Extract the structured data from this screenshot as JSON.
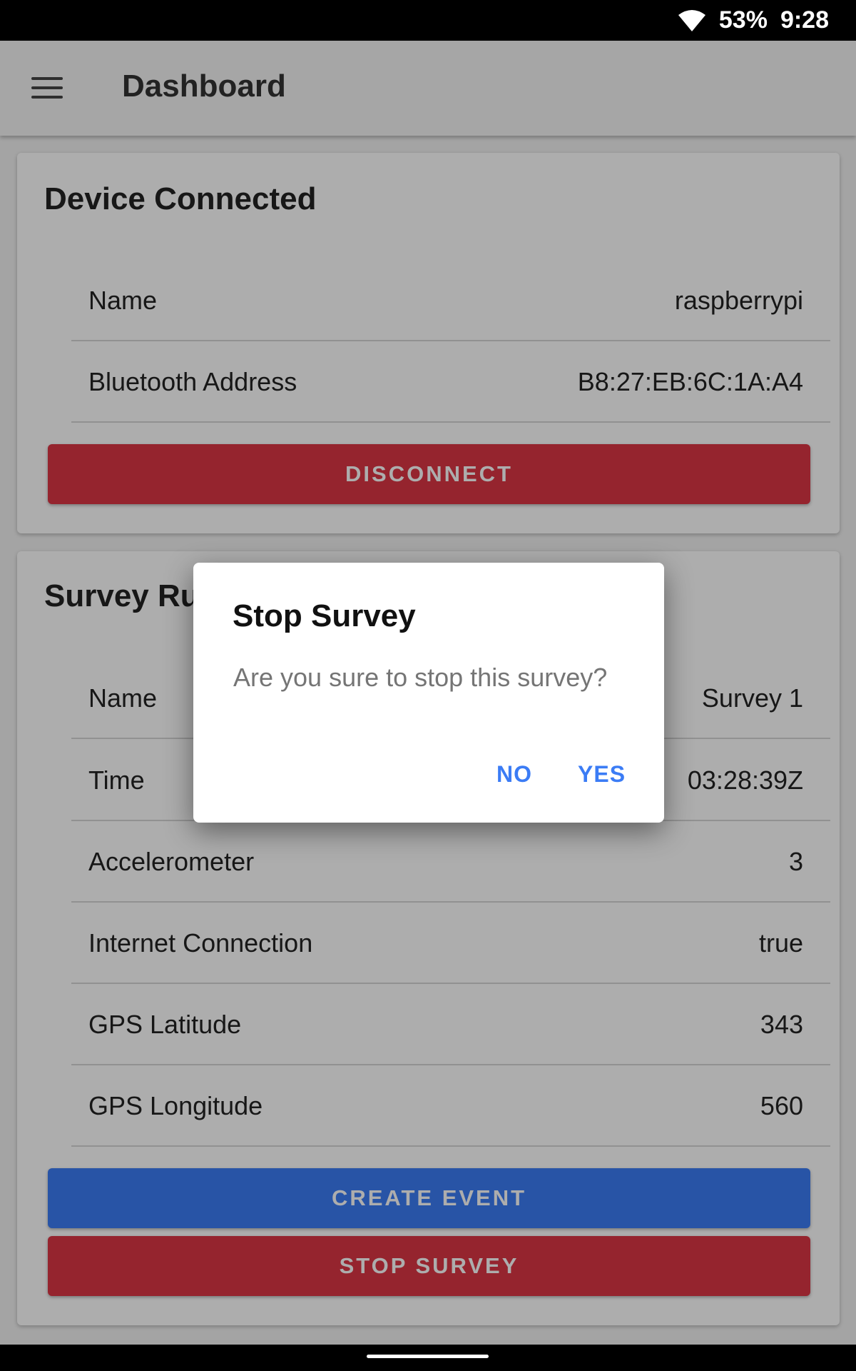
{
  "status_bar": {
    "battery": "53%",
    "time": "9:28"
  },
  "app_bar": {
    "title": "Dashboard"
  },
  "device_card": {
    "title": "Device Connected",
    "rows": [
      {
        "label": "Name",
        "value": "raspberrypi"
      },
      {
        "label": "Bluetooth Address",
        "value": "B8:27:EB:6C:1A:A4"
      }
    ],
    "disconnect_label": "DISCONNECT"
  },
  "survey_card": {
    "title": "Survey Ru",
    "rows": [
      {
        "label": "Name",
        "value": "Survey 1"
      },
      {
        "label": "Time",
        "value": "03:28:39Z"
      },
      {
        "label": "Accelerometer",
        "value": "3"
      },
      {
        "label": "Internet Connection",
        "value": "true"
      },
      {
        "label": "GPS Latitude",
        "value": "343"
      },
      {
        "label": "GPS Longitude",
        "value": "560"
      }
    ],
    "create_event_label": "CREATE EVENT",
    "stop_survey_label": "STOP SURVEY"
  },
  "dialog": {
    "title": "Stop Survey",
    "message": "Are you sure to stop this survey?",
    "no_label": "NO",
    "yes_label": "YES"
  },
  "colors": {
    "danger": "#dc3545",
    "primary": "#3b7cf5",
    "dialog_action": "#3b7cf5"
  }
}
